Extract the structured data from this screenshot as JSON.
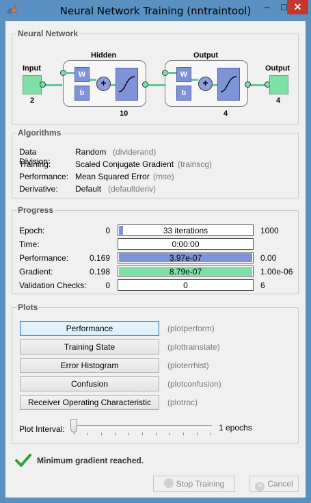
{
  "window": {
    "title": "Neural Network Training (nntraintool)"
  },
  "network": {
    "section_title": "Neural Network",
    "input_label": "Input",
    "input_size": "2",
    "hidden_label": "Hidden",
    "hidden_size": "10",
    "output_layer_label": "Output",
    "output_layer_size": "4",
    "output_label": "Output",
    "output_size": "4",
    "weight_label": "W",
    "bias_label": "b",
    "sum_symbol": "+"
  },
  "algorithms": {
    "section_title": "Algorithms",
    "rows": [
      {
        "label": "Data Division:",
        "value": "Random",
        "code": "(dividerand)"
      },
      {
        "label": "Training:",
        "value": "Scaled Conjugate Gradient",
        "code": "(trainscg)"
      },
      {
        "label": "Performance:",
        "value": "Mean Squared Error",
        "code": "(mse)"
      },
      {
        "label": "Derivative:",
        "value": "Default",
        "code": "(defaultderiv)"
      }
    ]
  },
  "progress": {
    "section_title": "Progress",
    "rows": [
      {
        "label": "Epoch:",
        "start": "0",
        "bar_text": "33 iterations",
        "end": "1000",
        "fill": 0.033,
        "color": "#7e93d8"
      },
      {
        "label": "Time:",
        "start": "",
        "bar_text": "0:00:00",
        "end": "",
        "fill": 0,
        "color": "#7e93d8"
      },
      {
        "label": "Performance:",
        "start": "0.169",
        "bar_text": "3.97e-07",
        "end": "0.00",
        "fill": 1.0,
        "color": "#7e93d8"
      },
      {
        "label": "Gradient:",
        "start": "0.198",
        "bar_text": "8.79e-07",
        "end": "1.00e-06",
        "fill": 1.0,
        "color": "#7fe0a6"
      },
      {
        "label": "Validation Checks:",
        "start": "0",
        "bar_text": "0",
        "end": "6",
        "fill": 0,
        "color": "#7e93d8"
      }
    ]
  },
  "plots": {
    "section_title": "Plots",
    "buttons": [
      {
        "label": "Performance",
        "code": "(plotperform)"
      },
      {
        "label": "Training State",
        "code": "(plottrainstate)"
      },
      {
        "label": "Error Histogram",
        "code": "(ploterrhist)"
      },
      {
        "label": "Confusion",
        "code": "(plotconfusion)"
      },
      {
        "label": "Receiver Operating Characteristic",
        "code": "(plotroc)"
      }
    ],
    "interval_label": "Plot Interval:",
    "interval_value": "1 epochs"
  },
  "status": {
    "message": "Minimum gradient reached.",
    "icon": "checkmark-icon",
    "color": "#2ea12e"
  },
  "footer": {
    "stop_label": "Stop Training",
    "cancel_label": "Cancel"
  }
}
